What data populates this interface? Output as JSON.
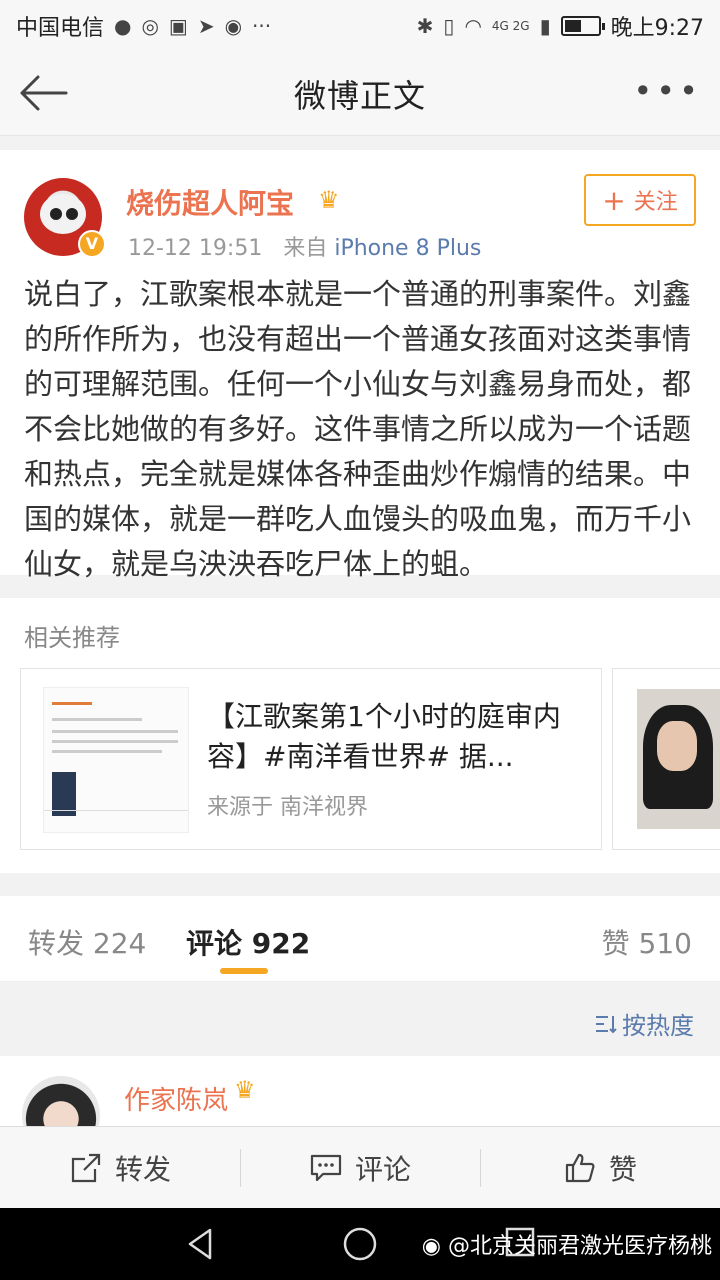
{
  "status_bar": {
    "carrier": "中国电信",
    "network": "4G 2G",
    "time": "晚上9:27",
    "battery_level": 0.5
  },
  "nav": {
    "title": "微博正文"
  },
  "post": {
    "author": "烧伤超人阿宝",
    "verified_badge": "V",
    "date": "12-12 19:51",
    "source_prefix": "来自",
    "device": "iPhone 8 Plus",
    "follow_label": "关注",
    "follow_plus": "+",
    "text": "说白了，江歌案根本就是一个普通的刑事案件。刘鑫的所作所为，也没有超出一个普通女孩面对这类事情的可理解范围。任何一个小仙女与刘鑫易身而处，都不会比她做的有多好。这件事情之所以成为一个话题和热点，完全就是媒体各种歪曲炒作煽情的结果。中国的媒体，就是一群吃人血馒头的吸血鬼，而万千小仙女，就是乌泱泱吞吃尸体上的蛆。"
  },
  "related": {
    "title": "相关推荐",
    "card": {
      "headline": "【江歌案第1个小时的庭审内容】#南洋看世界# 据...",
      "source": "来源于 南洋视界"
    }
  },
  "tabs": {
    "repost": "转发 224",
    "comment": "评论 922",
    "like": "赞 510"
  },
  "sort": {
    "label": "按热度"
  },
  "comment": {
    "author": "作家陈岚"
  },
  "toolbar": {
    "repost": "转发",
    "comment": "评论",
    "like": "赞"
  },
  "watermark": "@北京关丽君激光医疗杨桃",
  "colors": {
    "accent_orange": "#f5a623",
    "username": "#eb7350",
    "link_blue": "#5b7bad"
  },
  "icons": [
    "back-arrow-icon",
    "more-icon",
    "crown-icon",
    "repost-icon",
    "comment-icon",
    "like-icon",
    "sort-icon",
    "weibo-icon"
  ]
}
